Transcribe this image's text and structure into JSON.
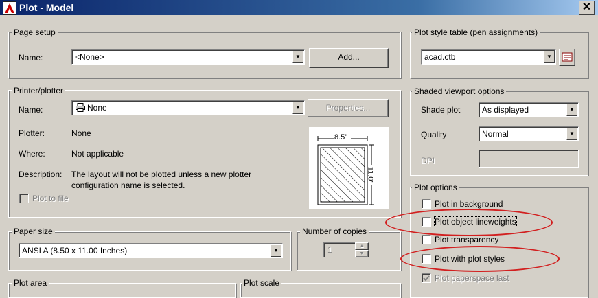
{
  "window": {
    "title": "Plot - Model",
    "close_glyph": "✕"
  },
  "page_setup": {
    "legend": "Page setup",
    "name_label": "Name:",
    "name_value": "<None>",
    "add_button": "Add..."
  },
  "printer_plotter": {
    "legend": "Printer/plotter",
    "name_label": "Name:",
    "name_value": "None",
    "properties_button": "Properties...",
    "plotter_label": "Plotter:",
    "plotter_value": "None",
    "where_label": "Where:",
    "where_value": "Not applicable",
    "description_label": "Description:",
    "description_line1": "The layout will not be plotted unless a new plotter",
    "description_line2": "configuration name is selected.",
    "plot_to_file": "Plot to file",
    "preview_width": "8.5\"",
    "preview_height": "11.0\""
  },
  "paper_size": {
    "legend": "Paper size",
    "value": "ANSI A (8.50 x 11.00 Inches)"
  },
  "copies": {
    "legend": "Number of copies",
    "value": "1"
  },
  "plot_area": {
    "legend": "Plot area"
  },
  "plot_scale": {
    "legend": "Plot scale"
  },
  "plot_style_table": {
    "legend": "Plot style table (pen assignments)",
    "value": "acad.ctb"
  },
  "shaded_viewport": {
    "legend": "Shaded viewport options",
    "shade_plot_label": "Shade plot",
    "shade_plot_value": "As displayed",
    "quality_label": "Quality",
    "quality_value": "Normal",
    "dpi_label": "DPI"
  },
  "plot_options": {
    "legend": "Plot options",
    "items": [
      {
        "label": "Plot in background",
        "checked": false
      },
      {
        "label": "Plot object lineweights",
        "checked": false
      },
      {
        "label": "Plot transparency",
        "checked": false
      },
      {
        "label": "Plot with plot styles",
        "checked": false
      },
      {
        "label": "Plot paperspace last",
        "checked": true
      }
    ]
  },
  "colors": {
    "highlight_oval": "#d21f1f",
    "dialog_bg": "#d4d0c8"
  }
}
